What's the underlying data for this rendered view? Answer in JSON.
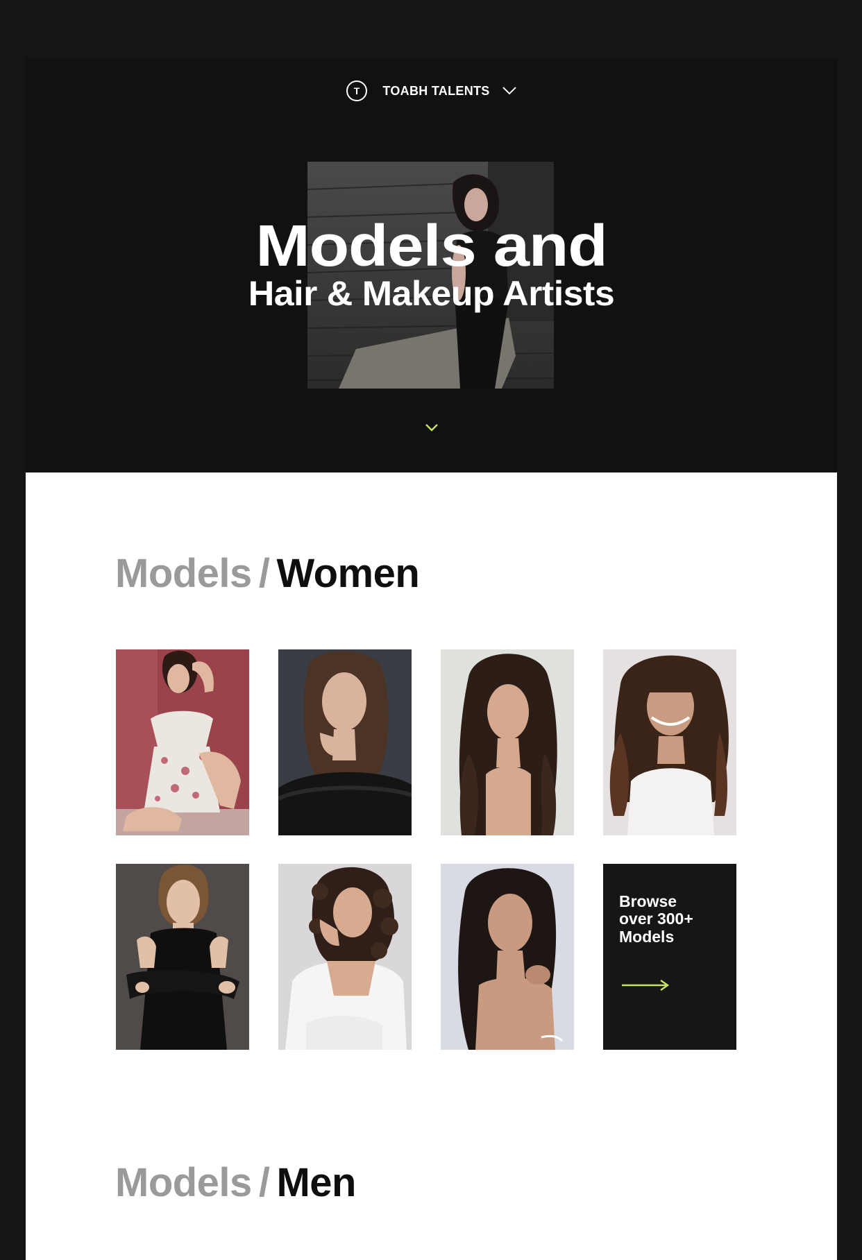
{
  "header": {
    "brand_name": "TOABH TALENTS",
    "logo_letter": "T",
    "logo_icon": "toabh-logo-icon",
    "dropdown_icon": "chevron-down-icon"
  },
  "hero": {
    "title_line_1": "Models and",
    "title_line_2": "Hair & Makeup Artists",
    "scroll_icon": "chevron-down-icon",
    "accent_color": "#c6e36b"
  },
  "sections": {
    "women": {
      "crumb": "Models",
      "separator": "/",
      "current": "Women"
    },
    "men": {
      "crumb": "Models",
      "separator": "/",
      "current": "Men"
    }
  },
  "women_grid": {
    "browse_card": {
      "text": "Browse\nover 300+\nModels",
      "arrow_icon": "arrow-right-icon"
    }
  },
  "colors": {
    "background": "#151515",
    "hero_bg": "#111111",
    "content_bg": "#ffffff",
    "heading_muted": "#9a9a9a",
    "heading_dark": "#0e0e0e",
    "accent": "#c6e36b"
  }
}
